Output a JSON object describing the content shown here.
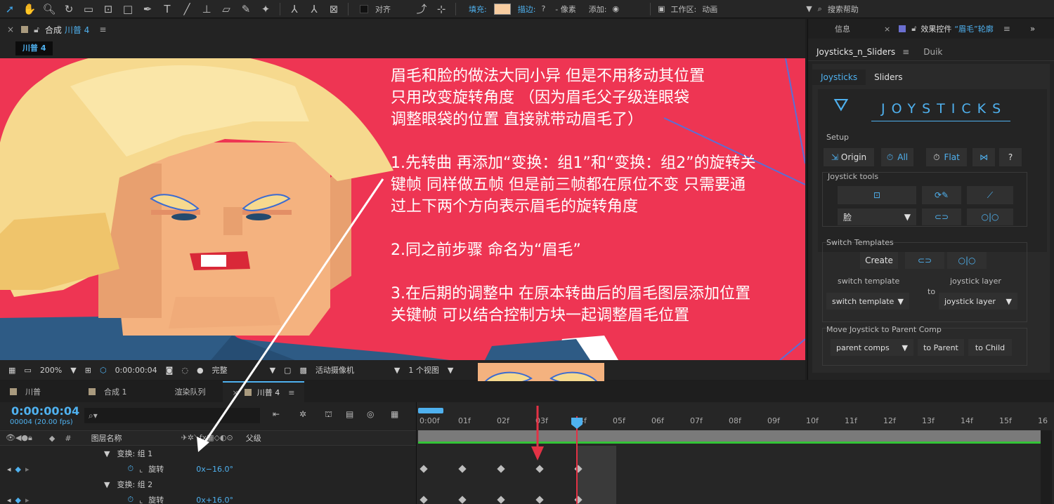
{
  "toolbar": {
    "align_label": "对齐",
    "fill_label": "填充:",
    "stroke_label": "描边:",
    "stroke_value": "?",
    "stroke_width": "- 像素",
    "add_label": "添加:",
    "workspace_label": "工作区:",
    "workspace_value": "动画",
    "search_help": "搜索帮助",
    "fill_color": "#f8cda0"
  },
  "comp_panel": {
    "close": "×",
    "tab_prefix": "合成",
    "tab_name": "川普 4",
    "menu": "≡",
    "chip": "川普 4"
  },
  "annotation": {
    "lines": [
      "眉毛和脸的做法大同小异 但是不用移动其位置",
      "只用改变旋转角度 （因为眉毛父子级连眼袋",
      "调整眼袋的位置 直接就带动眉毛了）",
      "",
      "1.先转曲 再添加“变换：组1”和“变换：组2”的旋转关",
      "键帧 同样做五帧 但是前三帧都在原位不变 只需要通",
      "过上下两个方向表示眉毛的旋转角度",
      "",
      "2.同之前步骤 命名为“眉毛”",
      "",
      "3.在后期的调整中 在原本转曲后的眉毛图层添加位置",
      "关键帧 可以结合控制方块一起调整眉毛位置"
    ]
  },
  "viewer_bottom": {
    "zoom": "200%",
    "timecode": "0:00:00:04",
    "quality": "完整",
    "camera": "活动摄像机",
    "views": "1 个视图"
  },
  "right_panel": {
    "tab_info": "信息",
    "tab_effects_prefix": "效果控件",
    "tab_effects_name": "“眉毛”轮廓",
    "subtab_joysticks_sliders": "Joysticks_n_Sliders",
    "subtab_duik": "Duik",
    "inner_tab_joysticks": "Joysticks",
    "inner_tab_sliders": "Sliders",
    "title": "JOYSTICKS",
    "setup_label": "Setup",
    "origin": "Origin",
    "all": "All",
    "flat": "Flat",
    "help": "?",
    "joystick_tools_label": "Joystick tools",
    "face_dropdown": "脸",
    "switch_templates_label": "Switch Templates",
    "create": "Create",
    "switch_template_label": "switch template",
    "joystick_layer_label": "joystick layer",
    "to": "to",
    "switch_template_dropdown": "switch template",
    "joystick_layer_dropdown": "joystick layer",
    "move_label": "Move Joystick to Parent Comp",
    "parent_comps": "parent comps",
    "to_parent": "to Parent",
    "to_child": "to Child"
  },
  "timeline": {
    "tabs": [
      "川普",
      "合成 1",
      "渲染队列",
      "川普 4"
    ],
    "timecode": "0:00:00:04",
    "frame_info": "00004 (20.00 fps)",
    "col_hash": "#",
    "col_layer_name": "图层名称",
    "col_parent": "父级",
    "rows": [
      {
        "label": "变换: 组 1",
        "type": "group"
      },
      {
        "label": "旋转",
        "value": "0x−16.0°",
        "type": "prop"
      },
      {
        "label": "变换: 组 2",
        "type": "group"
      },
      {
        "label": "旋转",
        "value": "0x+16.0°",
        "type": "prop"
      }
    ],
    "ruler": [
      "0:00f",
      "01f",
      "02f",
      "03f",
      "04f",
      "05f",
      "06f",
      "07f",
      "08f",
      "09f",
      "10f",
      "11f",
      "12f",
      "13f",
      "14f",
      "15f",
      "16"
    ]
  }
}
